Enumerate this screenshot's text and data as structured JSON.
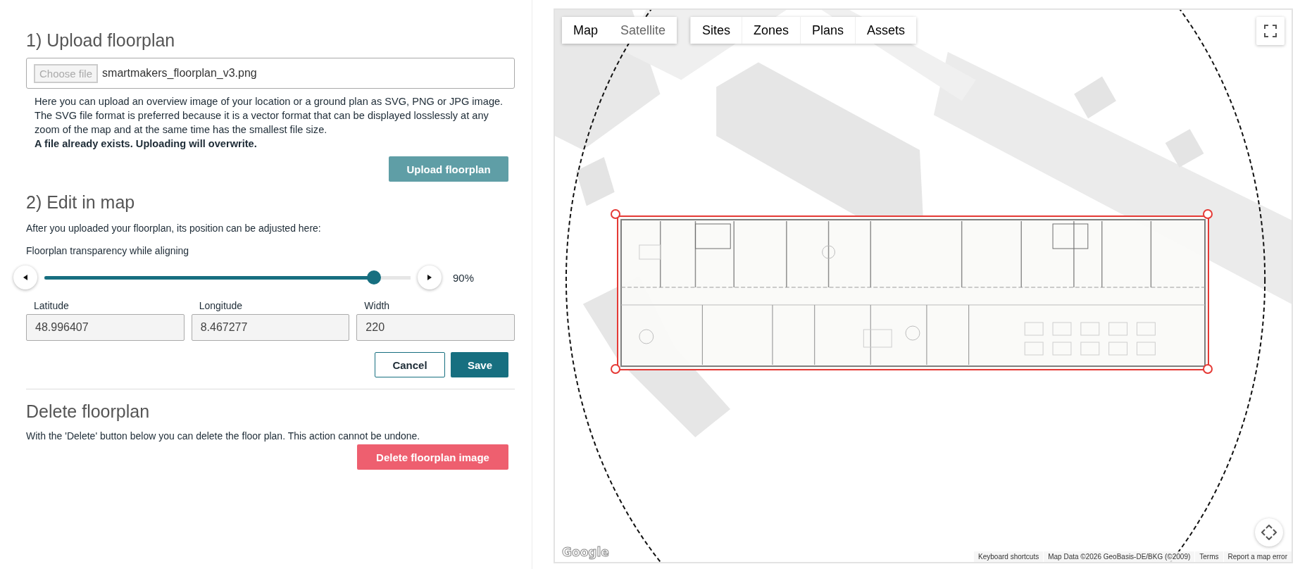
{
  "upload": {
    "heading": "1) Upload floorplan",
    "choose_button": "Choose file",
    "file_name": "smartmakers_floorplan_v3.png",
    "help": "Here you can upload an overview image of your location or a ground plan as SVG, PNG or JPG image. The SVG file format is preferred because it is a vector format that can be displayed losslessly at any zoom of the map and at the same time has the smallest file size.",
    "notice": "A file already exists. Uploading will overwrite.",
    "button": "Upload floorplan"
  },
  "edit": {
    "heading": "2) Edit in map",
    "intro": "After you uploaded your floorplan, its position can be adjusted here:",
    "slider": {
      "label": "Floorplan transparency while aligning",
      "level": 0.9,
      "reading": "90%"
    },
    "fields": [
      {
        "label": "Latitude",
        "value": "48.996407"
      },
      {
        "label": "Longitude",
        "value": "8.467277"
      },
      {
        "label": "Width",
        "value": "220"
      }
    ],
    "buttons": [
      {
        "label": "Cancel",
        "kind": "secondary"
      },
      {
        "label": "Save",
        "kind": "primary"
      }
    ]
  },
  "delete": {
    "heading": "Delete floorplan",
    "text": "With the 'Delete' button below you can delete the floor plan. This action cannot be undone.",
    "button": "Delete floorplan image"
  },
  "map": {
    "map_types": [
      {
        "label": "Map",
        "selected": true
      },
      {
        "label": "Satellite",
        "selected": false
      }
    ],
    "layers": [
      "Sites",
      "Zones",
      "Plans",
      "Assets"
    ],
    "logo": "Google",
    "attribution": [
      "Keyboard shortcuts",
      "Map Data ©2026 GeoBasis-DE/BKG (©2009)",
      "Terms",
      "Report a map error"
    ]
  }
}
